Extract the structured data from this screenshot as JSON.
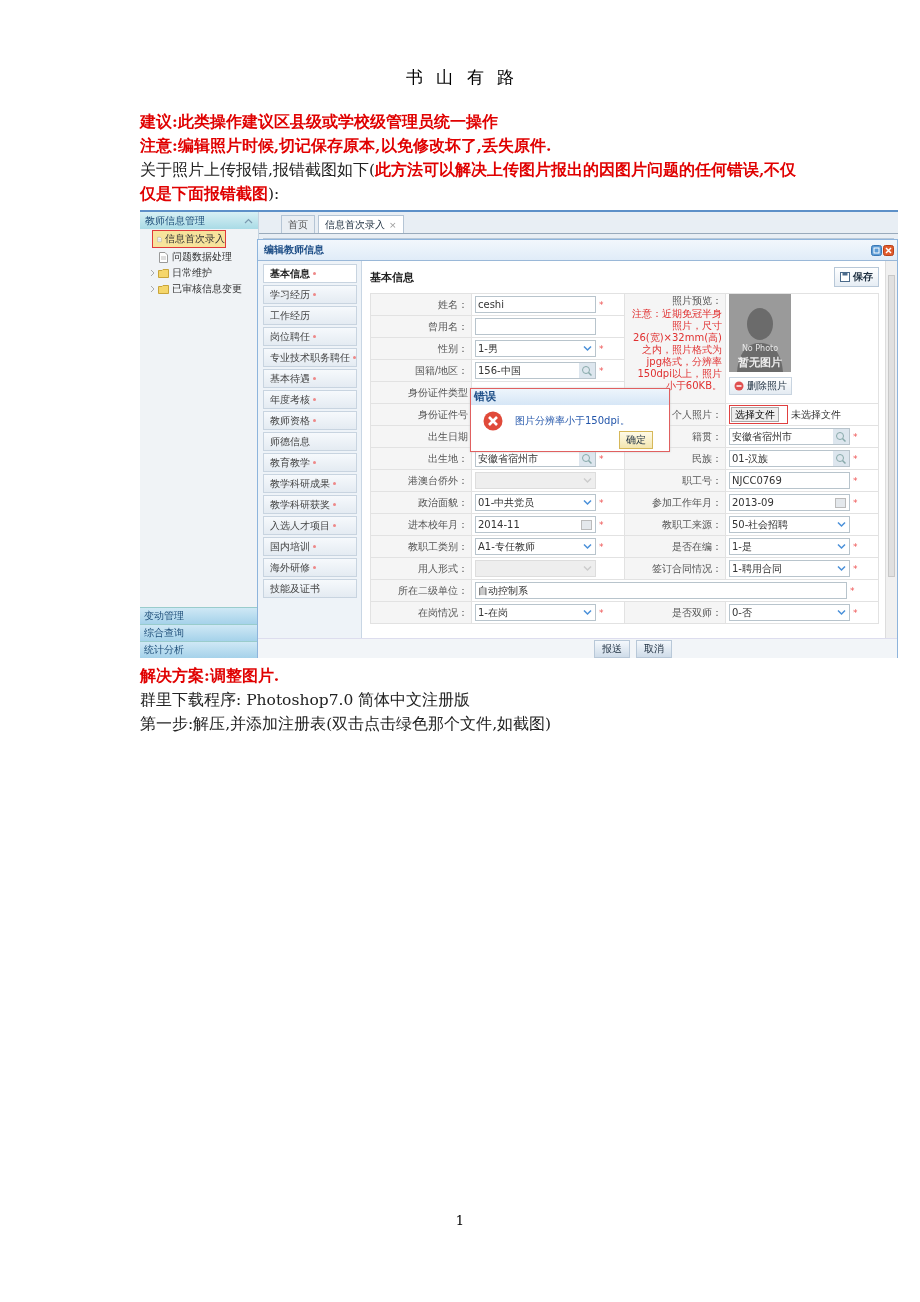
{
  "page_header": "书 山 有 路",
  "notes_before": [
    {
      "text": "建议:此类操作建议区县级或学校级管理员统一操作",
      "kind": "warning"
    },
    {
      "text": "注意:编辑照片时候,切记保存原本,以免修改坏了,丢失原件.",
      "kind": "warning"
    },
    {
      "text": "关于照片上传报错,报错截图如下(**此方法可以解决上传图片报出的因图片问题的任何错误,不仅仅是下面报错截图**):",
      "kind": "plain"
    }
  ],
  "screenshot": {
    "nav": {
      "title": "教师信息管理",
      "items": [
        {
          "label": "信息首次录入",
          "kind": "page",
          "selected": true
        },
        {
          "label": "问题数据处理",
          "kind": "page",
          "selected": false
        },
        {
          "label": "日常维护",
          "kind": "folder",
          "selected": false
        },
        {
          "label": "已审核信息变更",
          "kind": "folder",
          "selected": false
        }
      ],
      "accordions": [
        "变动管理",
        "综合查询",
        "统计分析"
      ]
    },
    "tabs": [
      {
        "label": "首页",
        "selected": false
      },
      {
        "label": "信息首次录入",
        "selected": true,
        "close": "×"
      }
    ],
    "dialog": {
      "title": "编辑教师信息",
      "sections": [
        {
          "label": "基本信息",
          "selected": true,
          "required": true
        },
        {
          "label": "学习经历",
          "selected": false,
          "required": true
        },
        {
          "label": "工作经历",
          "selected": false,
          "required": false
        },
        {
          "label": "岗位聘任",
          "selected": false,
          "required": true
        },
        {
          "label": "专业技术职务聘任",
          "selected": false,
          "required": true
        },
        {
          "label": "基本待遇",
          "selected": false,
          "required": true
        },
        {
          "label": "年度考核",
          "selected": false,
          "required": true
        },
        {
          "label": "教师资格",
          "selected": false,
          "required": true
        },
        {
          "label": "师德信息",
          "selected": false,
          "required": false
        },
        {
          "label": "教育教学",
          "selected": false,
          "required": true
        },
        {
          "label": "教学科研成果",
          "selected": false,
          "required": true
        },
        {
          "label": "教学科研获奖",
          "selected": false,
          "required": true
        },
        {
          "label": "入选人才项目",
          "selected": false,
          "required": true
        },
        {
          "label": "国内培训",
          "selected": false,
          "required": true
        },
        {
          "label": "海外研修",
          "selected": false,
          "required": true
        },
        {
          "label": "技能及证书",
          "selected": false,
          "required": false
        }
      ],
      "heading": "基本信息",
      "save": "保存",
      "photo": {
        "label": "照片预览：",
        "note": "注意：近期免冠半身照片，尺寸26(宽)×32mm(高)之内，照片格式为jpg格式，分辨率150dpi以上，照片小于60KB。",
        "caption_small": "No Photo",
        "caption": "暂无图片",
        "delete": "删除照片"
      },
      "rows": [
        [
          {
            "label": "姓名：",
            "kind": "text",
            "value": "ceshi",
            "required": "*"
          }
        ],
        [
          {
            "label": "曾用名：",
            "kind": "text"
          }
        ],
        [
          {
            "label": "性别：",
            "kind": "select",
            "value": "1-男",
            "required": "*"
          }
        ],
        [
          {
            "label": "国籍/地区：",
            "kind": "lookup",
            "value": "156-中国",
            "required": "*"
          }
        ],
        [
          {
            "label": "身份证件类型"
          }
        ],
        [
          {
            "label": "身份证件号"
          },
          {
            "label": "个人照片：",
            "kind": "file",
            "button": "选择文件",
            "value": "未选择文件",
            "highlighted": true
          }
        ],
        [
          {
            "label": "出生日期"
          },
          {
            "label": "籍贯：",
            "kind": "lookup",
            "value": "安徽省宿州市",
            "required": "*"
          }
        ],
        [
          {
            "label": "出生地：",
            "kind": "lookup",
            "value": "安徽省宿州市",
            "required": "*"
          },
          {
            "label": "民族：",
            "kind": "lookup",
            "value": "01-汉族",
            "required": "*"
          }
        ],
        [
          {
            "label": "港澳台侨外：",
            "kind": "select",
            "disabled": true
          },
          {
            "label": "职工号：",
            "kind": "text",
            "value": "NJCC0769",
            "required": "*"
          }
        ],
        [
          {
            "label": "政治面貌：",
            "kind": "select",
            "value": "01-中共党员",
            "required": "*"
          },
          {
            "label": "参加工作年月：",
            "kind": "date",
            "value": "2013-09",
            "required": "*"
          }
        ],
        [
          {
            "label": "进本校年月：",
            "kind": "date",
            "value": "2014-11",
            "required": "*"
          },
          {
            "label": "教职工来源：",
            "kind": "select",
            "value": "50-社会招聘"
          }
        ],
        [
          {
            "label": "教职工类别：",
            "kind": "select",
            "value": "A1-专任教师",
            "required": "*"
          },
          {
            "label": "是否在编：",
            "kind": "select",
            "value": "1-是",
            "required": "*"
          }
        ],
        [
          {
            "label": "用人形式：",
            "kind": "select",
            "disabled": true
          },
          {
            "label": "签订合同情况：",
            "kind": "select",
            "value": "1-聘用合同",
            "required": "*"
          }
        ],
        [
          {
            "label": "所在二级单位：",
            "kind": "text",
            "value": "自动控制系",
            "required": "*",
            "wide": true
          }
        ],
        [
          {
            "label": "在岗情况：",
            "kind": "select",
            "value": "1-在岗",
            "required": "*"
          },
          {
            "label": "是否双师：",
            "kind": "select",
            "value": "0-否",
            "required": "*"
          }
        ]
      ],
      "buttons": [
        "报送",
        "取消"
      ],
      "error": {
        "title": "错误",
        "message": "图片分辨率小于150dpi。",
        "ok": "确定"
      }
    }
  },
  "notes_after": [
    {
      "text": "解决方案:调整图片.",
      "kind": "warning"
    },
    {
      "text": "群里下载程序: Photoshop7.0 简体中文注册版",
      "kind": "plain"
    },
    {
      "text": "第一步:解压,并添加注册表(双击点击绿色那个文件,如截图)",
      "kind": "plain"
    }
  ],
  "page_number": "1"
}
